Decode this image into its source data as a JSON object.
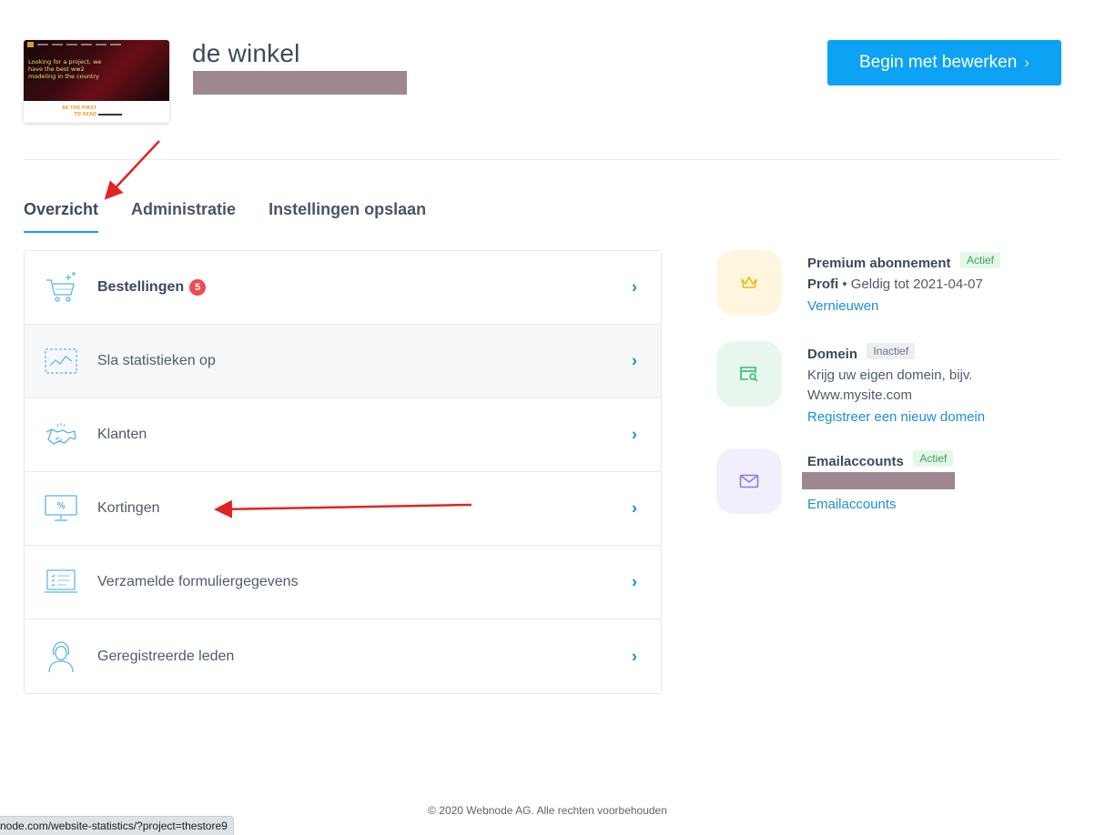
{
  "header": {
    "site_title": "de winkel",
    "edit_button": "Begin met bewerken",
    "thumbnail": {
      "headline": "Looking for a project, we have the best ww2 modeling in the country",
      "cta": "BE THE FIRST TO READ"
    }
  },
  "tabs": [
    {
      "label": "Overzicht",
      "active": true
    },
    {
      "label": "Administratie",
      "active": false
    },
    {
      "label": "Instellingen opslaan",
      "active": false
    }
  ],
  "menu": [
    {
      "label": "Bestellingen",
      "badge": "5",
      "icon": "shopping-cart-icon"
    },
    {
      "label": "Sla statistieken op",
      "icon": "statistics-chart-icon"
    },
    {
      "label": "Klanten",
      "icon": "handshake-icon"
    },
    {
      "label": "Kortingen",
      "icon": "discount-monitor-icon"
    },
    {
      "label": "Verzamelde formuliergegevens",
      "icon": "form-laptop-icon"
    },
    {
      "label": "Geregistreerde leden",
      "icon": "member-avatar-icon"
    }
  ],
  "services": {
    "premium": {
      "title": "Premium abonnement",
      "status": "Actief",
      "plan": "Profi",
      "valid": " • Geldig tot 2021-04-07",
      "link": "Vernieuwen",
      "icon": "crown-icon",
      "color": "#f2b705"
    },
    "domain": {
      "title": "Domein",
      "status": "Inactief",
      "desc": "Krijg uw eigen domein, bijv. Www.mysite.com",
      "link": "Registreer een nieuw domein",
      "icon": "domain-search-icon",
      "color": "#2fbf71"
    },
    "email": {
      "title": "Emailaccounts",
      "status": "Actief",
      "link": "Emailaccounts",
      "icon": "envelope-icon",
      "color": "#8b78e6"
    }
  },
  "footer": {
    "copyright": "© 2020 Webnode AG. Alle rechten voorbehouden"
  },
  "statusbar": {
    "url": "node.com/website-statistics/?project=thestore9"
  },
  "colors": {
    "accent": "#0ea2f5",
    "link": "#1c8fd8",
    "badge": "#ef4a52",
    "annotation": "#e02424"
  }
}
